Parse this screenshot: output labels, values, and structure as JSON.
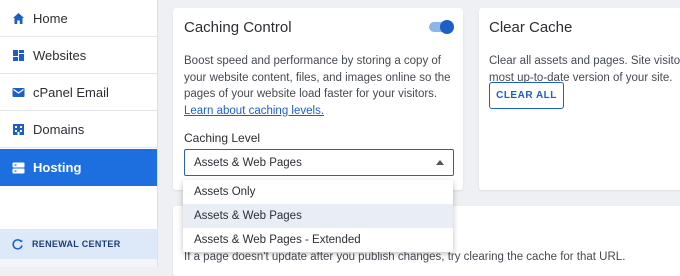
{
  "sidebar": {
    "items": [
      {
        "label": "Home",
        "icon": "home-icon"
      },
      {
        "label": "Websites",
        "icon": "websites-icon"
      },
      {
        "label": "cPanel Email",
        "icon": "email-icon"
      },
      {
        "label": "Domains",
        "icon": "domains-icon"
      },
      {
        "label": "Hosting",
        "icon": "hosting-icon",
        "active": true
      }
    ],
    "renewal": {
      "label": "RENEWAL CENTER",
      "icon": "renew-icon"
    }
  },
  "caching": {
    "title": "Caching Control",
    "toggle_on": true,
    "desc_lines": [
      "Boost speed and performance by storing a copy of",
      "your website content, files, and images online so the",
      "pages of your website load faster for your visitors."
    ],
    "link": "Learn about caching levels.",
    "level_label": "Caching Level",
    "selected": "Assets & Web Pages",
    "options": [
      "Assets Only",
      "Assets & Web Pages",
      "Assets & Web Pages - Extended"
    ]
  },
  "clear": {
    "title": "Clear Cache",
    "desc_lines": [
      "Clear all assets and pages. Site visitors",
      "most up-to-date version of your site."
    ],
    "button": "CLEAR ALL"
  },
  "bottom": {
    "text": "If a page doesn't update after you publish changes, try clearing the cache for that URL."
  },
  "colors": {
    "accent": "#1d6fe0",
    "link": "#1d5fc7",
    "renewal_bg": "#dde8f8"
  }
}
